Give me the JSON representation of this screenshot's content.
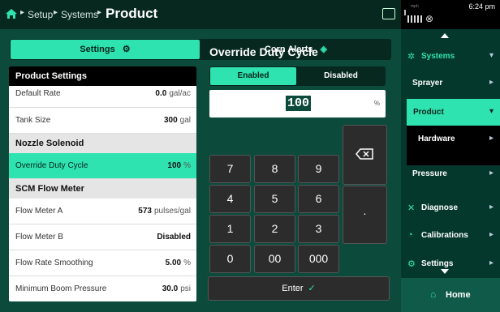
{
  "header": {
    "breadcrumb": [
      "Setup",
      "Systems"
    ],
    "title": "Product",
    "time": "6:24 pm",
    "speed_unit": "mph"
  },
  "tabs": {
    "settings": "Settings",
    "corn_alerts": "Corn Alerts"
  },
  "product_settings": {
    "header": "Product Settings",
    "rows": [
      {
        "label": "Default Rate",
        "value": "0.0",
        "unit": "gal/ac"
      },
      {
        "label": "Tank Size",
        "value": "300",
        "unit": "gal"
      }
    ]
  },
  "nozzle_solenoid": {
    "header": "Nozzle Solenoid",
    "rows": [
      {
        "label": "Override Duty Cycle",
        "value": "100",
        "unit": "%"
      }
    ]
  },
  "scm_flow_meter": {
    "header": "SCM Flow Meter",
    "rows": [
      {
        "label": "Flow Meter A",
        "value": "573",
        "unit": "pulses/gal"
      },
      {
        "label": "Flow Meter B",
        "value": "Disabled",
        "unit": ""
      },
      {
        "label": "Flow Rate Smoothing",
        "value": "5.00",
        "unit": "%"
      },
      {
        "label": "Minimum Boom Pressure",
        "value": "30.0",
        "unit": "psi"
      }
    ]
  },
  "editor": {
    "title": "Override Duty Cycle",
    "enabled_label": "Enabled",
    "disabled_label": "Disabled",
    "value": "100",
    "unit": "%",
    "keys": [
      "7",
      "8",
      "9",
      "4",
      "5",
      "6",
      "1",
      "2",
      "3",
      "0",
      "00",
      "000"
    ],
    "dot": ".",
    "enter": "Enter"
  },
  "nav": {
    "systems": "Systems",
    "sprayer": "Sprayer",
    "product": "Product",
    "hardware": "Hardware",
    "pressure": "Pressure",
    "diagnose": "Diagnose",
    "calibrations": "Calibrations",
    "settings": "Settings",
    "home": "Home"
  },
  "colors": {
    "accent": "#2fe3b0",
    "background": "#0c4a3c"
  }
}
